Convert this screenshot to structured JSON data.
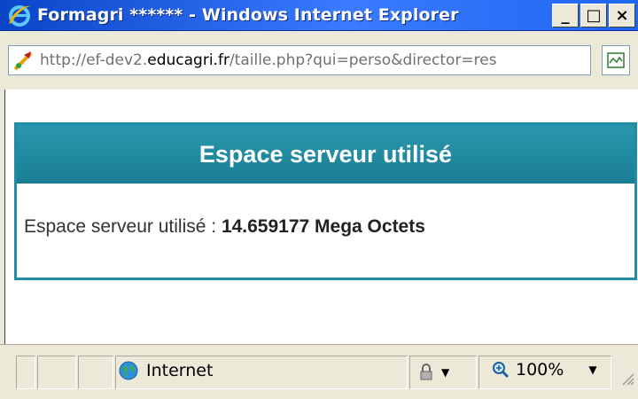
{
  "window": {
    "title": "Formagri ****** - Windows Internet Explorer",
    "buttons": {
      "minimize": "_",
      "maximize": "□",
      "close": "×"
    }
  },
  "address": {
    "url_prefix": "http://ef-dev2.",
    "url_domain": "educagri.fr",
    "url_suffix": "/taille.php?qui=perso&director=res"
  },
  "panel": {
    "title": "Espace serveur utilisé",
    "label": "Espace serveur utilisé : ",
    "value": "14.659177 Mega Octets"
  },
  "status": {
    "zone": "Internet",
    "zoom": "100%"
  },
  "colors": {
    "panel_accent": "#1f8da3",
    "titlebar": "#0a45c8"
  }
}
